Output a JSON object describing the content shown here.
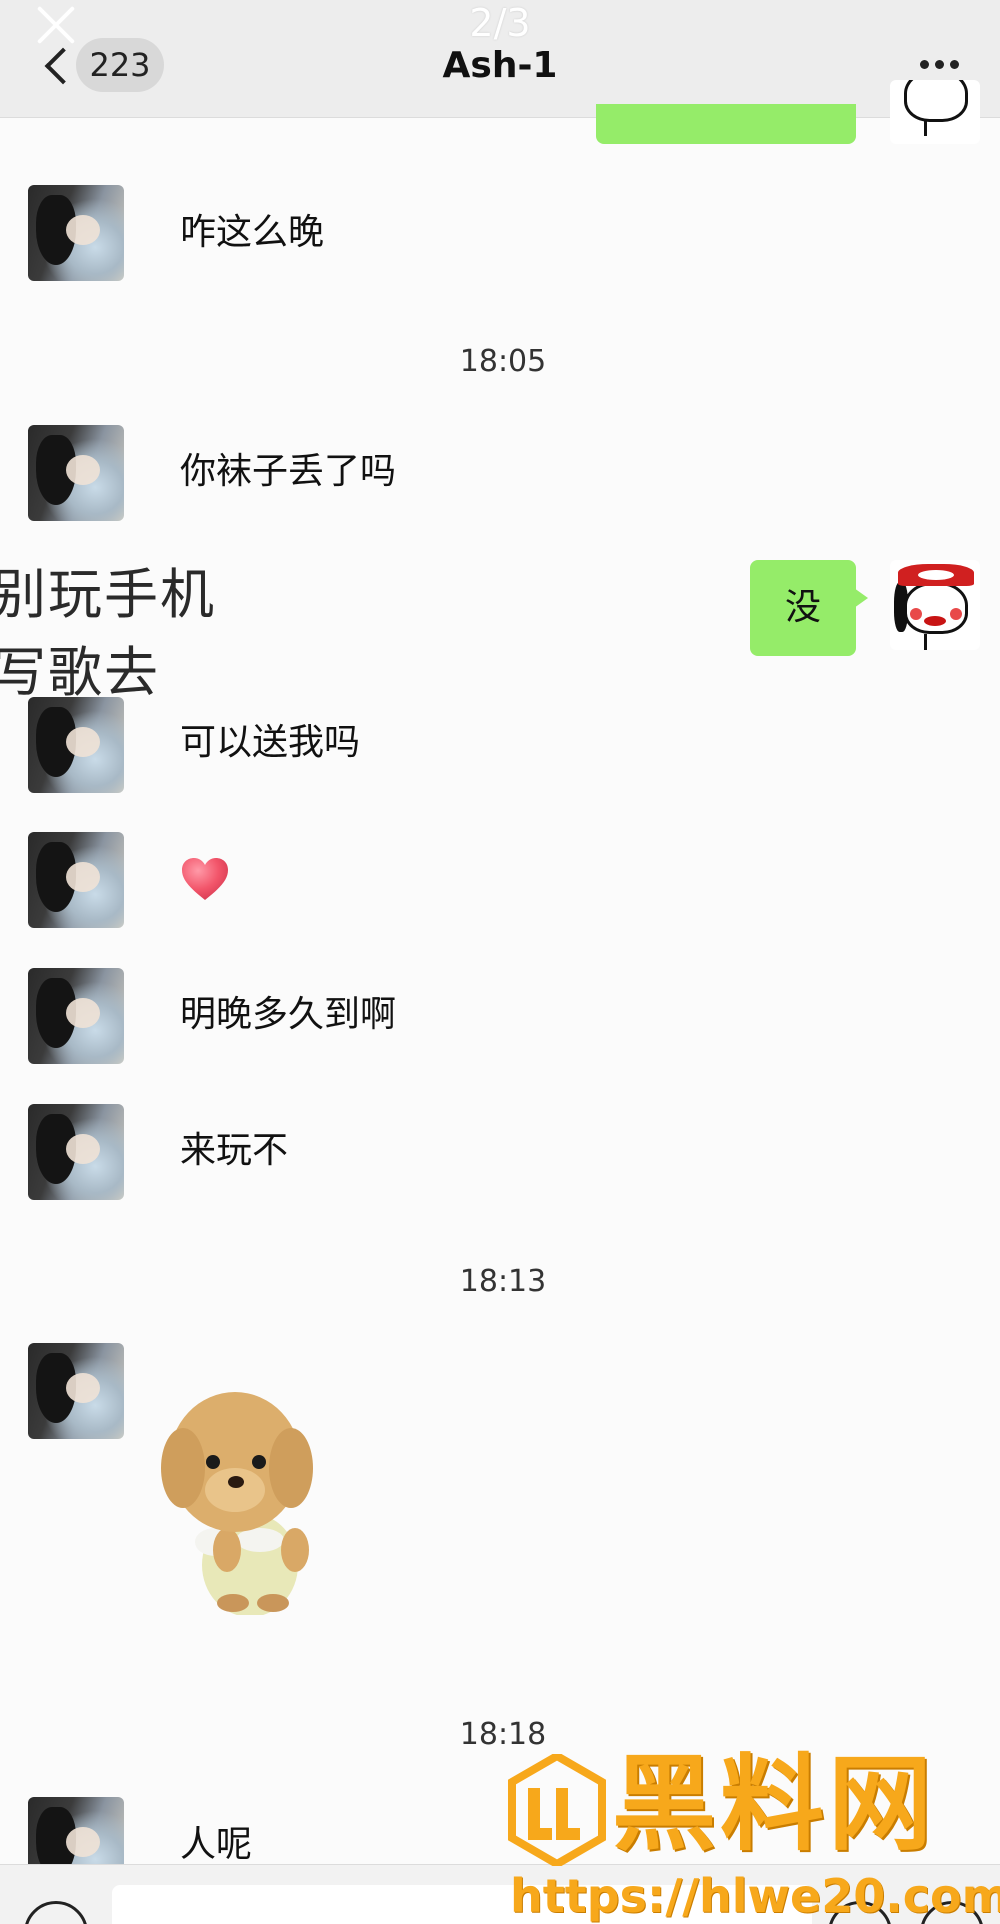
{
  "header": {
    "viewer_page": "2/3",
    "unread_count": "223",
    "title": "Ash-1"
  },
  "overlay_caption": [
    "别玩手机",
    "写歌去"
  ],
  "messages": [
    {
      "from": "contact",
      "text": "咋这么晚"
    },
    {
      "from": "time",
      "text": "18:05"
    },
    {
      "from": "contact",
      "text": "你袜子丢了吗"
    },
    {
      "from": "me",
      "text": "没"
    },
    {
      "from": "contact",
      "text": "可以送我吗"
    },
    {
      "from": "contact",
      "emoji": "heart-emoji"
    },
    {
      "from": "contact",
      "text": "明晚多久到啊"
    },
    {
      "from": "contact",
      "text": "来玩不"
    },
    {
      "from": "time",
      "text": "18:13"
    },
    {
      "from": "contact",
      "sticker": "plush-dog-sticker"
    },
    {
      "from": "time",
      "text": "18:18"
    },
    {
      "from": "contact",
      "text": "人呢"
    }
  ],
  "watermark": {
    "title": "黑料网",
    "url": "https://hlwe20.com"
  },
  "colors": {
    "my_bubble": "#95ec69",
    "header_bg": "#ededed",
    "watermark": "#f7a81b"
  }
}
